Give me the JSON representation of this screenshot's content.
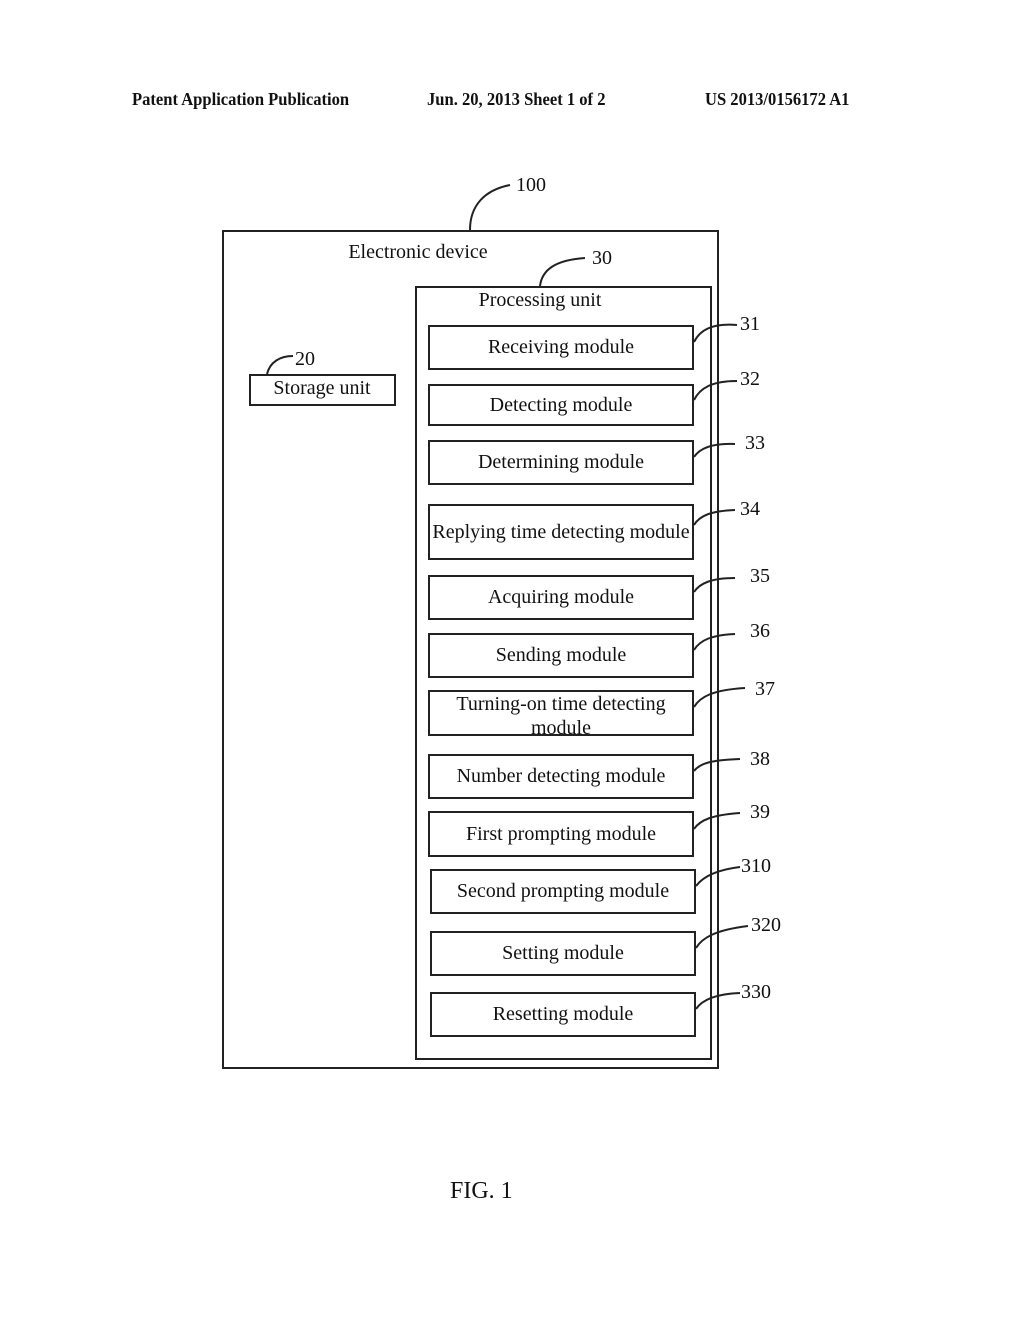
{
  "header": {
    "publication": "Patent Application Publication",
    "date_sheet": "Jun. 20, 2013  Sheet 1 of 2",
    "number": "US 2013/0156172 A1"
  },
  "diagram": {
    "device": {
      "label": "Electronic device",
      "ref": "100"
    },
    "storage": {
      "label": "Storage unit",
      "ref": "20"
    },
    "processing": {
      "label": "Processing unit",
      "ref": "30"
    },
    "modules": [
      {
        "label": "Receiving module",
        "ref": "31"
      },
      {
        "label": "Detecting module",
        "ref": "32"
      },
      {
        "label": "Determining module",
        "ref": "33"
      },
      {
        "label": "Replying time detecting module",
        "ref": "34"
      },
      {
        "label": "Acquiring module",
        "ref": "35"
      },
      {
        "label": "Sending module",
        "ref": "36"
      },
      {
        "label": "Turning-on time detecting module",
        "ref": "37"
      },
      {
        "label": "Number detecting module",
        "ref": "38"
      },
      {
        "label": "First prompting module",
        "ref": "39"
      },
      {
        "label": "Second prompting module",
        "ref": "310"
      },
      {
        "label": "Setting module",
        "ref": "320"
      },
      {
        "label": "Resetting module",
        "ref": "330"
      }
    ]
  },
  "figure_caption": "FIG. 1"
}
